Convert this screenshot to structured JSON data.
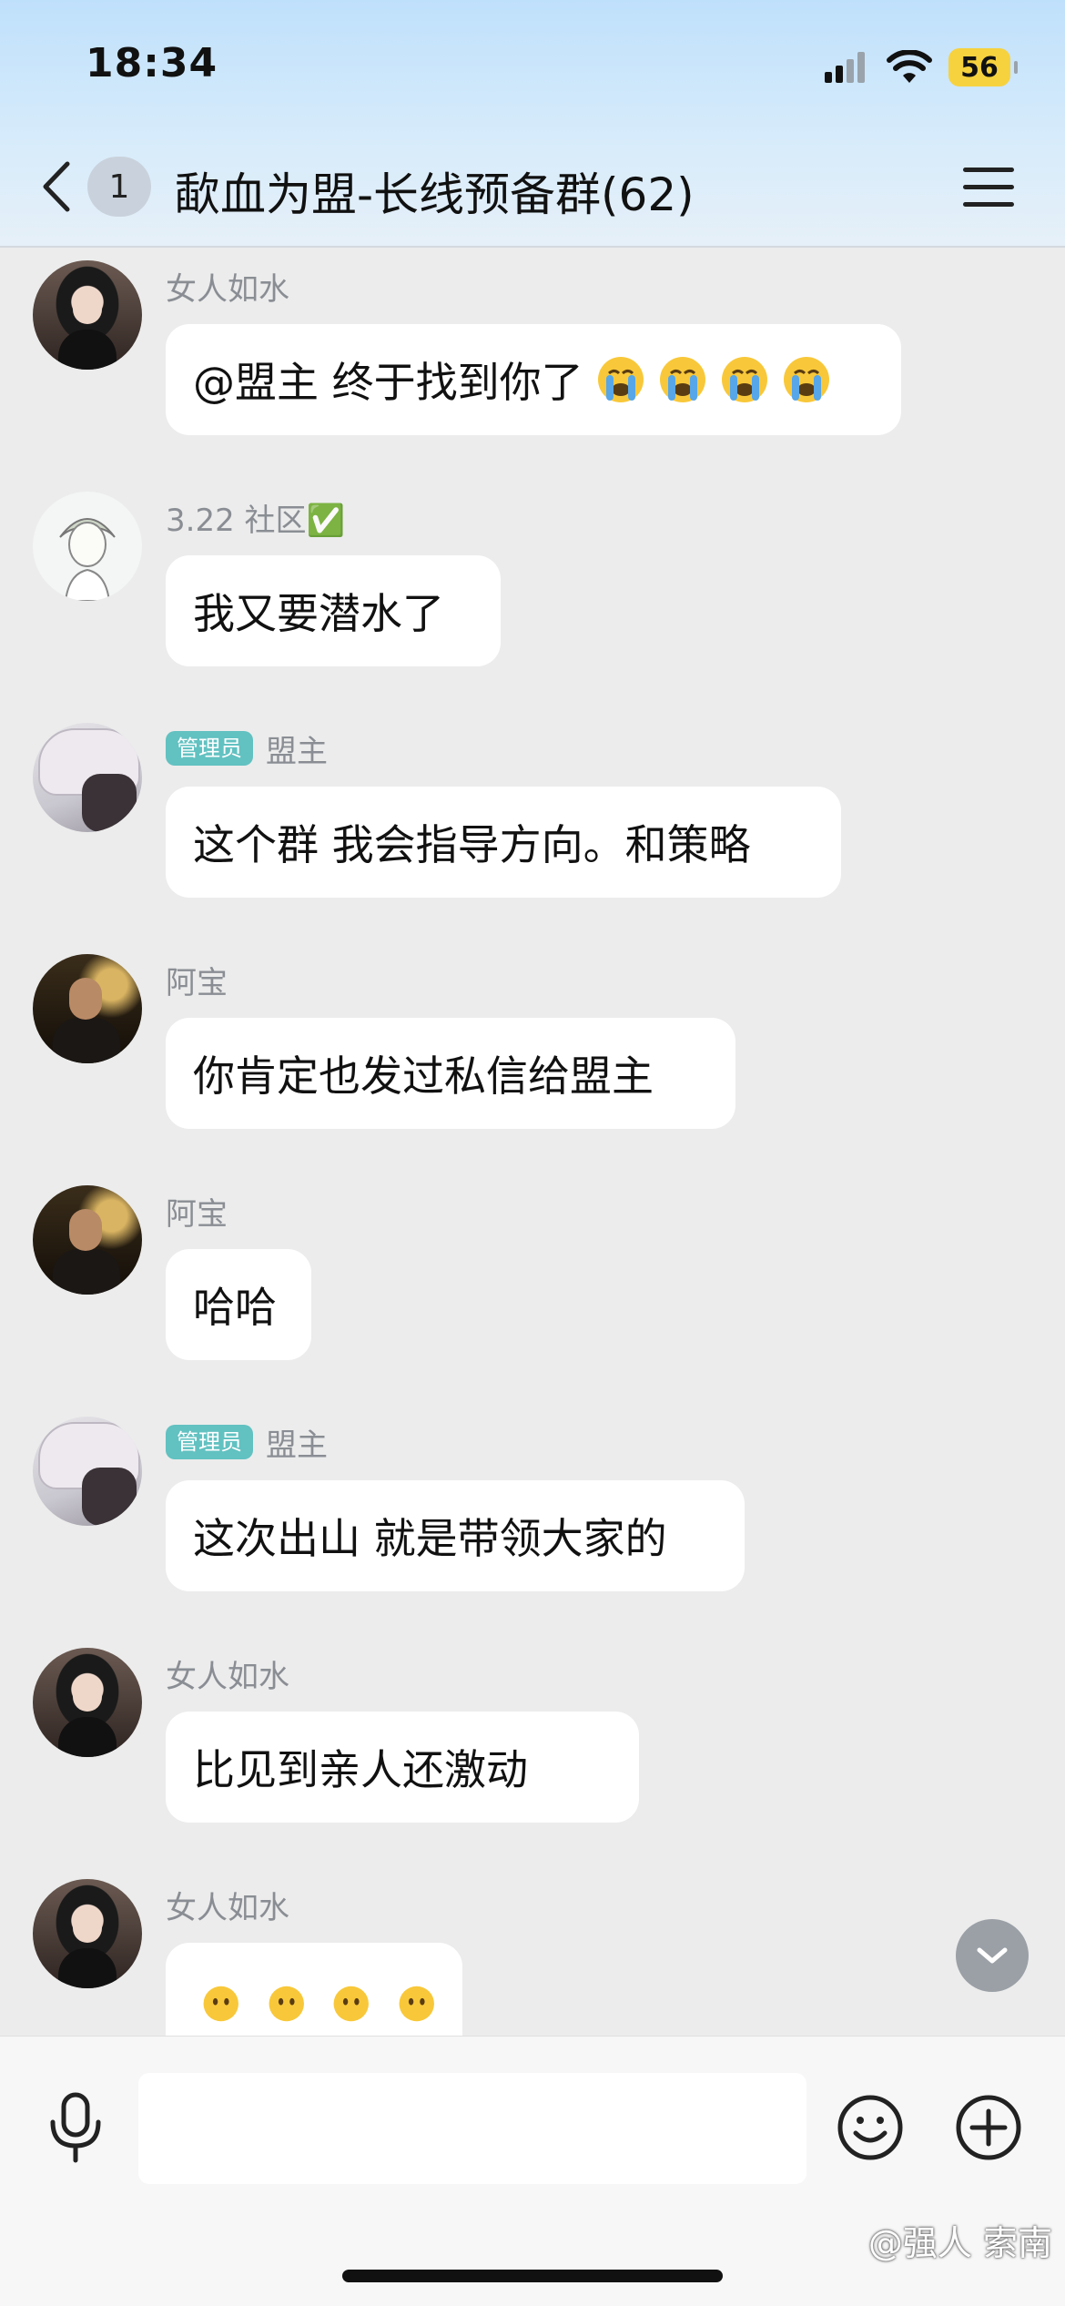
{
  "status_bar": {
    "time": "18:34",
    "battery": "56"
  },
  "header": {
    "unread_count": "1",
    "title": "歃血为盟-长线预备群(62)"
  },
  "messages": [
    {
      "sender": "女人如水",
      "avatar": "woman-avatar",
      "admin": "",
      "text": "@盟主 终于找到你了",
      "emojis": [
        "loudly-crying-face",
        "loudly-crying-face",
        "loudly-crying-face",
        "loudly-crying-face"
      ]
    },
    {
      "sender": "3.22 社区✅",
      "avatar": "sketch-avatar",
      "admin": "",
      "text": "我又要潜水了"
    },
    {
      "sender": "盟主",
      "avatar": "anime-avatar",
      "admin": "管理员",
      "text": "这个群 我会指导方向。和策略"
    },
    {
      "sender": "阿宝",
      "avatar": "man-avatar",
      "admin": "",
      "text": "你肯定也发过私信给盟主"
    },
    {
      "sender": "阿宝",
      "avatar": "man-avatar",
      "admin": "",
      "text": "哈哈"
    },
    {
      "sender": "盟主",
      "avatar": "anime-avatar",
      "admin": "管理员",
      "text": "这次出山 就是带领大家的"
    },
    {
      "sender": "女人如水",
      "avatar": "woman-avatar",
      "admin": "",
      "text": "比见到亲人还激动"
    },
    {
      "sender": "女人如水",
      "avatar": "woman-avatar",
      "admin": "",
      "text": "",
      "emojis": [
        "face-without-mouth",
        "face-without-mouth",
        "face-without-mouth",
        "face-without-mouth"
      ]
    }
  ],
  "input": {
    "value": "",
    "placeholder": ""
  },
  "watermark": "@强人 索南",
  "colors": {
    "admin_badge": "#62c1c1",
    "bubble": "#ffffff",
    "background": "#ececec"
  }
}
